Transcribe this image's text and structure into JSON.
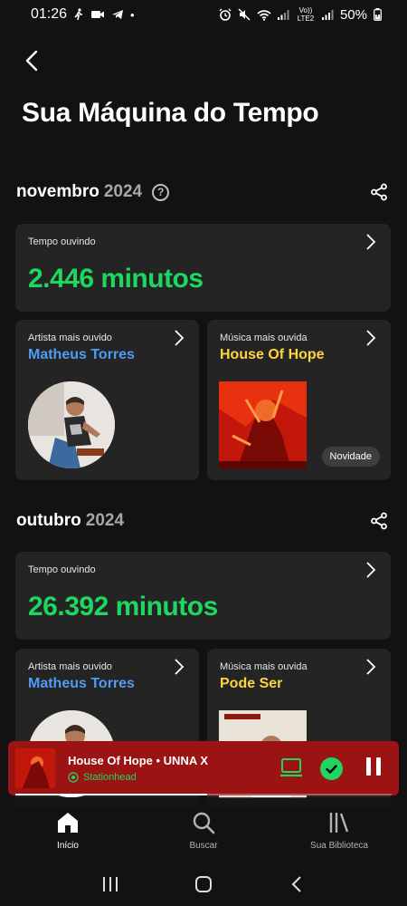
{
  "status_bar": {
    "time": "01:26",
    "battery": "50%",
    "network": "Vo)) LTE2"
  },
  "page": {
    "title": "Sua Máquina do Tempo"
  },
  "months": [
    {
      "month": "novembro",
      "year": "2024",
      "listening_label": "Tempo ouvindo",
      "minutes": "2.446 minutos",
      "artist_label": "Artista mais ouvido",
      "artist": "Matheus Torres",
      "song_label": "Música mais ouvida",
      "song": "House Of Hope",
      "song_badge": "Novidade"
    },
    {
      "month": "outubro",
      "year": "2024",
      "listening_label": "Tempo ouvindo",
      "minutes": "26.392 minutos",
      "artist_label": "Artista mais ouvido",
      "artist": "Matheus Torres",
      "song_label": "Música mais ouvida",
      "song": "Pode Ser"
    }
  ],
  "player": {
    "title": "House Of Hope • UNNA X",
    "source": "Stationhead",
    "progress": 0.51
  },
  "nav": {
    "items": [
      {
        "label": "Início",
        "icon": "home-icon",
        "active": true
      },
      {
        "label": "Buscar",
        "icon": "search-icon",
        "active": false
      },
      {
        "label": "Sua Biblioteca",
        "icon": "library-icon",
        "active": false
      }
    ]
  },
  "colors": {
    "background": "#121212",
    "card": "#242424",
    "green": "#1ed760",
    "artist_blue": "#509bf5",
    "song_yellow": "#ffd43b",
    "player_red": "#9b1313"
  }
}
